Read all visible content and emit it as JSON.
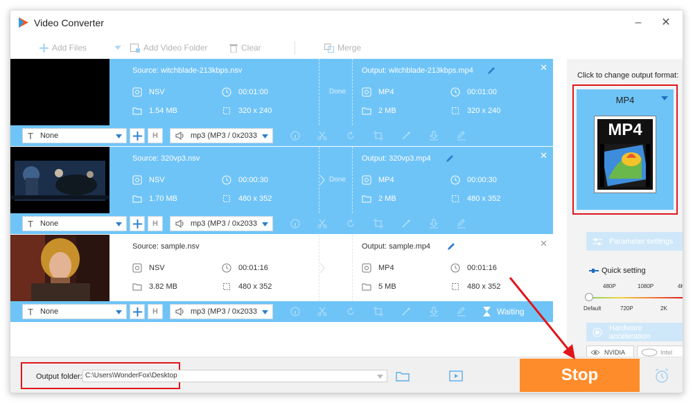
{
  "window": {
    "title": "Video Converter"
  },
  "toolbar": {
    "add_files": "Add Files",
    "add_video_folder": "Add Video Folder",
    "clear": "Clear",
    "merge": "Merge"
  },
  "tasks": [
    {
      "source": "Source: witchblade-213kbps.nsv",
      "output": "Output: witchblade-213kbps.mp4",
      "status": "Done",
      "src_format": "NSV",
      "src_duration": "00:01:00",
      "src_size": "1.54 MB",
      "src_res": "320 x 240",
      "out_format": "MP4",
      "out_duration": "00:01:00",
      "out_size": "2 MB",
      "out_res": "320 x 240",
      "subtitle": "None",
      "audio": "mp3 (MP3  / 0x2033"
    },
    {
      "source": "Source: 320vp3.nsv",
      "output": "Output: 320vp3.mp4",
      "status": "Done",
      "src_format": "NSV",
      "src_duration": "00:00:30",
      "src_size": "1.70 MB",
      "src_res": "480 x 352",
      "out_format": "MP4",
      "out_duration": "00:00:30",
      "out_size": "2 MB",
      "out_res": "480 x 352",
      "subtitle": "None",
      "audio": "mp3 (MP3  / 0x2033"
    },
    {
      "source": "Source: sample.nsv",
      "output": "Output: sample.mp4",
      "status": "",
      "src_format": "NSV",
      "src_duration": "00:01:16",
      "src_size": "3.82 MB",
      "src_res": "480 x 352",
      "out_format": "MP4",
      "out_duration": "00:01:16",
      "out_size": "5 MB",
      "out_res": "480 x 352",
      "subtitle": "None",
      "audio": "mp3 (MP3  / 0x2033",
      "waiting": "Waiting"
    }
  ],
  "right_panel": {
    "hint": "Click to change output format:",
    "format": "MP4",
    "format_badge": "MP4",
    "parameter_settings": "Parameter settings",
    "quick_setting": "Quick setting",
    "quality_top": [
      "480P",
      "1080P",
      "4K"
    ],
    "quality_bottom": [
      "Default",
      "720P",
      "2K"
    ],
    "hardware_acceleration": "Hardware acceleration",
    "nvidia": "NVIDIA",
    "intel": "Intel"
  },
  "bottom": {
    "output_folder_label": "Output folder:",
    "output_folder_path": "C:\\Users\\WonderFox\\Desktop",
    "stop": "Stop"
  },
  "colors": {
    "accent_blue": "#6fc4f7",
    "stop_orange": "#ff8c2a",
    "highlight_red": "#e0151a"
  }
}
